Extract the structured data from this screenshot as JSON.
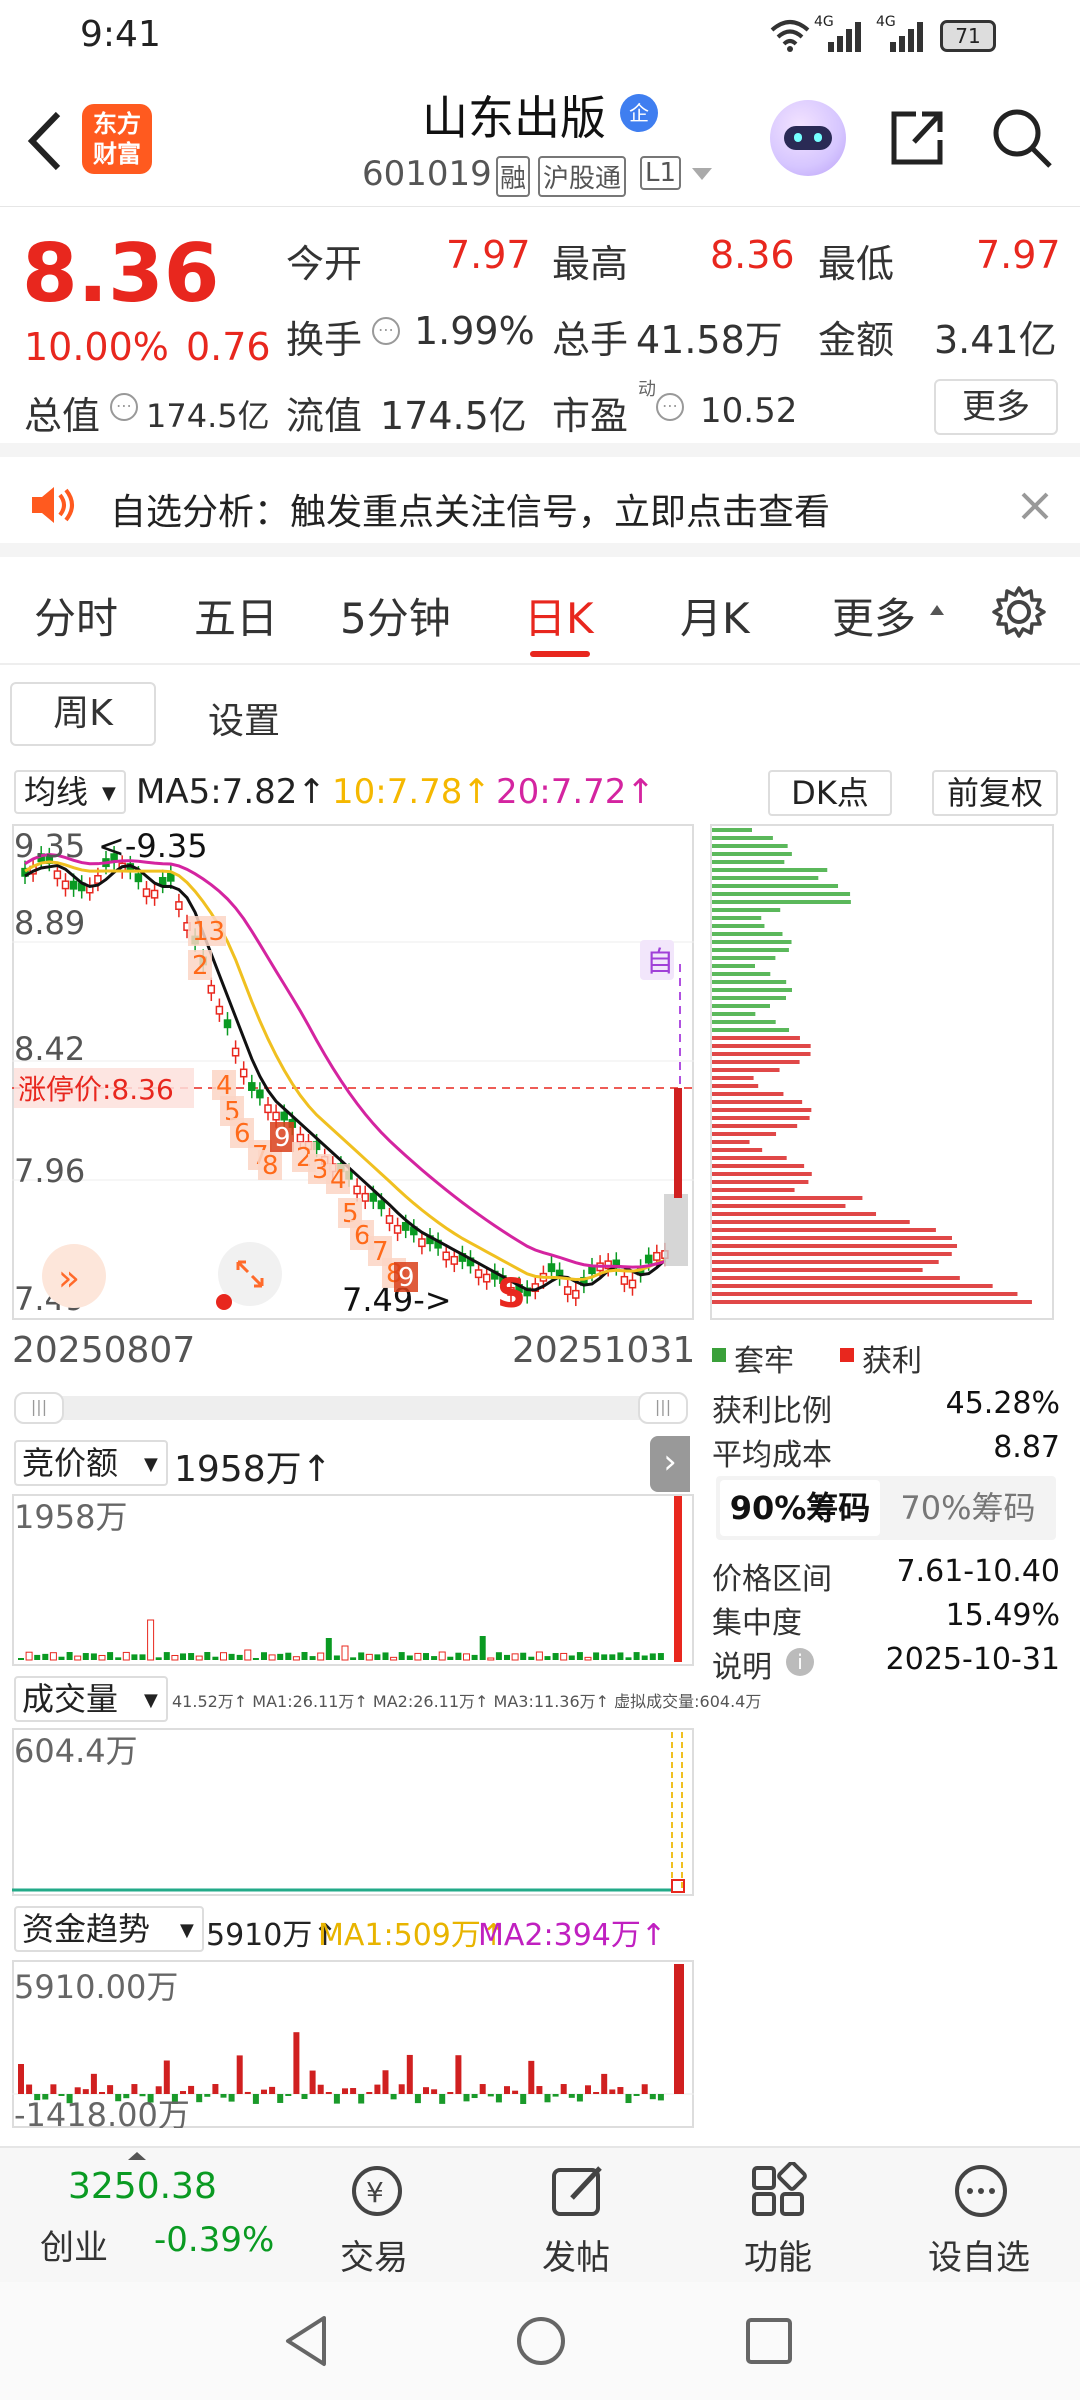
{
  "status_bar": {
    "time": "9:41",
    "signal1": "4G",
    "signal2": "4G",
    "battery": "71"
  },
  "header": {
    "logo_line1": "东方",
    "logo_line2": "财富",
    "title": "山东出版",
    "code": "601019",
    "tags": [
      "融",
      "沪股通",
      "L1"
    ],
    "badge": "企"
  },
  "quote": {
    "price": "8.36",
    "change_pct": "10.00%",
    "change": "0.76",
    "fields": [
      {
        "label": "今开",
        "value": "7.97"
      },
      {
        "label": "最高",
        "value": "8.36"
      },
      {
        "label": "最低",
        "value": "7.97"
      },
      {
        "label": "换手",
        "value": "1.99%"
      },
      {
        "label": "总手",
        "value": "41.58万"
      },
      {
        "label": "金额",
        "value": "3.41亿"
      },
      {
        "label": "总值",
        "value": "174.5亿"
      },
      {
        "label": "流值",
        "value": "174.5亿"
      },
      {
        "label": "市盈",
        "value": "10.52",
        "sup": "动"
      }
    ],
    "more": "更多"
  },
  "notice": {
    "text": "自选分析：触发重点关注信号，立即点击查看"
  },
  "tabs": [
    "分时",
    "五日",
    "5分钟",
    "日K",
    "月K",
    "更多"
  ],
  "active_tab": "日K",
  "subtabs": {
    "weekly": "周K",
    "settings": "设置"
  },
  "chart_header": {
    "ma_select": "均线",
    "ma5": "MA5:7.82↑",
    "ma10": "10:7.78↑",
    "ma20": "20:7.72↑",
    "dk": "DK点",
    "fq": "前复权"
  },
  "kchart": {
    "y_labels": [
      "9.35",
      "8.89",
      "8.42",
      "7.96",
      "7.49"
    ],
    "high_marker": "<-9.35",
    "low_marker": "7.49->",
    "limit_label": "涨停价:8.36",
    "start_date": "20250807",
    "end_date": "20251031",
    "self_marker": "自",
    "s_marker": "S",
    "seq_labels": [
      "13",
      "2",
      "4",
      "5",
      "6",
      "7",
      "8",
      "9",
      "2",
      "3",
      "4",
      "5",
      "6",
      "7",
      "8",
      "9"
    ]
  },
  "chips": {
    "legend_loss": "套牢",
    "legend_profit": "获利",
    "rows": [
      {
        "label": "获利比例",
        "value": "45.28%"
      },
      {
        "label": "平均成本",
        "value": "8.87"
      }
    ],
    "tab90": "90%筹码",
    "tab70": "70%筹码",
    "rows2": [
      {
        "label": "价格区间",
        "value": "7.61-10.40"
      },
      {
        "label": "集中度",
        "value": "15.49%"
      },
      {
        "label": "说明",
        "value": "2025-10-31"
      }
    ]
  },
  "auction": {
    "label": "竞价额",
    "value": "1958万↑",
    "axis": "1958万"
  },
  "volume": {
    "label": "成交量",
    "legend": "41.52万↑ MA1:26.11万↑ MA2:26.11万↑ MA3:11.36万↑ 虚拟成交量:604.4万",
    "axis": "604.4万"
  },
  "fund": {
    "label": "资金趋势",
    "value": "5910万↑",
    "ma1": "MA1:509万↑",
    "ma2": "MA2:394万↑",
    "axis_top": "5910.00万",
    "axis_bottom": "-1418.00万"
  },
  "bottom_nav": {
    "index_value": "3250.38",
    "index_name": "创业",
    "index_change": "-0.39%",
    "items": [
      "交易",
      "发帖",
      "功能",
      "设自选"
    ]
  }
}
